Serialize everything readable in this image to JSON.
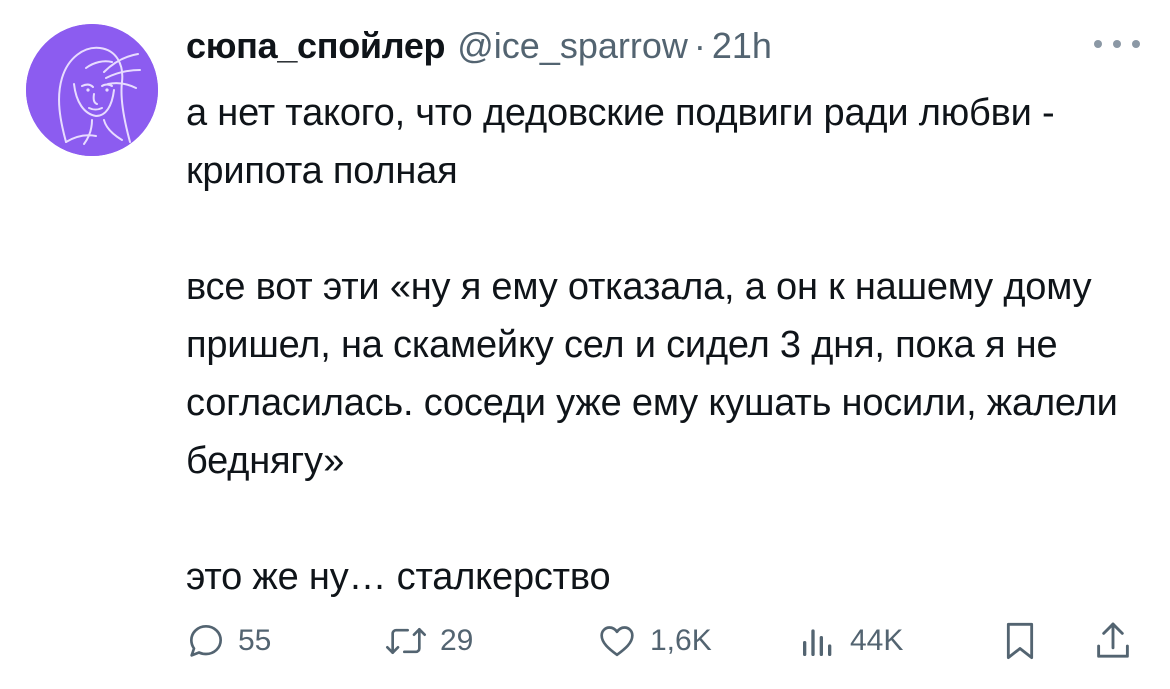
{
  "tweet": {
    "author": {
      "display_name": "сюпа_спойлер",
      "handle": "@ice_sparrow",
      "separator": "·",
      "timestamp": "21h"
    },
    "paragraphs": [
      "а нет такого, что дедовские подвиги ради любви - крипота полная",
      "все вот эти «ну я ему отказала, а он к нашему дому пришел, на скамейку сел и сидел 3 дня, пока я не согласилась. соседи уже ему кушать носили, жалели беднягу»",
      "это же ну… сталкерство"
    ],
    "actions": {
      "replies": "55",
      "reposts": "29",
      "likes": "1,6K",
      "views": "44K"
    }
  },
  "icons": {
    "more": "more-horizontal-icon",
    "reply": "reply-icon",
    "repost": "repost-icon",
    "like": "heart-icon",
    "views": "views-icon",
    "bookmark": "bookmark-icon",
    "share": "share-icon"
  },
  "colors": {
    "text": "#0f1419",
    "secondary": "#536471",
    "avatar_background": "#8c5cf0"
  }
}
